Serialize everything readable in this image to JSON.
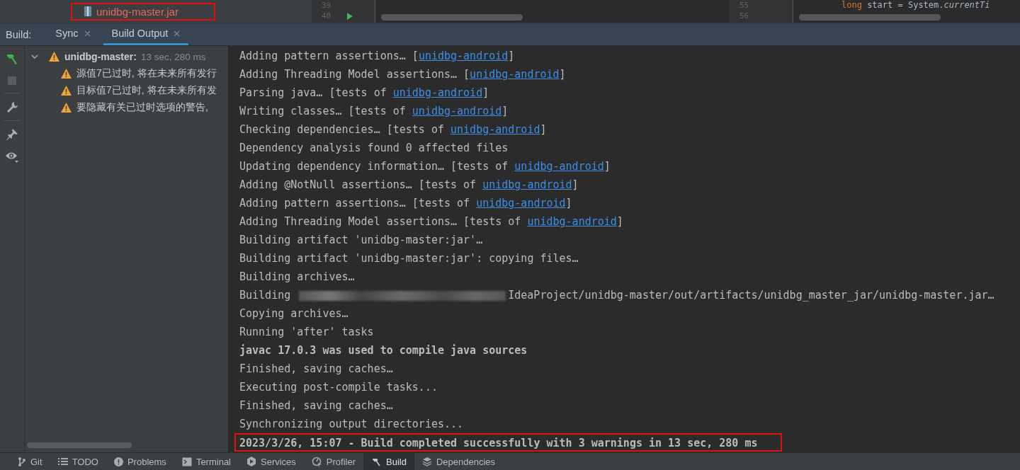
{
  "project_tree": {
    "item": "unidbg-master.jar",
    "highlighted": true
  },
  "editors": [
    {
      "line_numbers": [
        "39",
        "40"
      ],
      "run_marker": true
    },
    {
      "line_numbers": [
        "55",
        "56"
      ],
      "code": [
        {
          "kind": "keyword",
          "text": "long"
        },
        {
          "kind": "plain",
          "text": " start = System."
        },
        {
          "kind": "italic",
          "text": "currentTi"
        }
      ]
    }
  ],
  "build_tabs": {
    "label": "Build:",
    "tabs": [
      {
        "label": "Sync",
        "selected": false
      },
      {
        "label": "Build Output",
        "selected": true
      }
    ]
  },
  "tree": {
    "label": "unidbg-master:",
    "time": "13 sec, 280 ms",
    "expanded": true,
    "children": [
      {
        "label": "源值7已过时, 将在未来所有发行"
      },
      {
        "label": "目标值7已过时, 将在未来所有发"
      },
      {
        "label": "要隐藏有关已过时选项的警告,"
      }
    ]
  },
  "output": {
    "lines": [
      {
        "kind": "normal",
        "parts": [
          {
            "kind": "text",
            "text": "Adding pattern assertions… ["
          },
          {
            "kind": "link",
            "text": "unidbg-android"
          },
          {
            "kind": "text",
            "text": "]"
          }
        ]
      },
      {
        "kind": "normal",
        "parts": [
          {
            "kind": "text",
            "text": "Adding Threading Model assertions… ["
          },
          {
            "kind": "link",
            "text": "unidbg-android"
          },
          {
            "kind": "text",
            "text": "]"
          }
        ]
      },
      {
        "kind": "normal",
        "parts": [
          {
            "kind": "text",
            "text": "Parsing java… [tests of "
          },
          {
            "kind": "link",
            "text": "unidbg-android"
          },
          {
            "kind": "text",
            "text": "]"
          }
        ]
      },
      {
        "kind": "normal",
        "parts": [
          {
            "kind": "text",
            "text": "Writing classes… [tests of "
          },
          {
            "kind": "link",
            "text": "unidbg-android"
          },
          {
            "kind": "text",
            "text": "]"
          }
        ]
      },
      {
        "kind": "normal",
        "parts": [
          {
            "kind": "text",
            "text": "Checking dependencies… [tests of "
          },
          {
            "kind": "link",
            "text": "unidbg-android"
          },
          {
            "kind": "text",
            "text": "]"
          }
        ]
      },
      {
        "kind": "normal",
        "parts": [
          {
            "kind": "text",
            "text": "Dependency analysis found 0 affected files"
          }
        ]
      },
      {
        "kind": "normal",
        "parts": [
          {
            "kind": "text",
            "text": "Updating dependency information… [tests of "
          },
          {
            "kind": "link",
            "text": "unidbg-android"
          },
          {
            "kind": "text",
            "text": "]"
          }
        ]
      },
      {
        "kind": "normal",
        "parts": [
          {
            "kind": "text",
            "text": "Adding @NotNull assertions… [tests of "
          },
          {
            "kind": "link",
            "text": "unidbg-android"
          },
          {
            "kind": "text",
            "text": "]"
          }
        ]
      },
      {
        "kind": "normal",
        "parts": [
          {
            "kind": "text",
            "text": "Adding pattern assertions… [tests of "
          },
          {
            "kind": "link",
            "text": "unidbg-android"
          },
          {
            "kind": "text",
            "text": "]"
          }
        ]
      },
      {
        "kind": "normal",
        "parts": [
          {
            "kind": "text",
            "text": "Adding Threading Model assertions… [tests of "
          },
          {
            "kind": "link",
            "text": "unidbg-android"
          },
          {
            "kind": "text",
            "text": "]"
          }
        ]
      },
      {
        "kind": "normal",
        "parts": [
          {
            "kind": "text",
            "text": "Building artifact 'unidbg-master:jar'…"
          }
        ]
      },
      {
        "kind": "normal",
        "parts": [
          {
            "kind": "text",
            "text": "Building artifact 'unidbg-master:jar': copying files…"
          }
        ]
      },
      {
        "kind": "normal",
        "parts": [
          {
            "kind": "text",
            "text": "Building archives…"
          }
        ]
      },
      {
        "kind": "normal",
        "parts": [
          {
            "kind": "text",
            "text": "Building"
          },
          {
            "kind": "redacted"
          },
          {
            "kind": "text",
            "text": "IdeaProject/unidbg-master/out/artifacts/unidbg_master_jar/unidbg-master.jar…"
          }
        ]
      },
      {
        "kind": "normal",
        "parts": [
          {
            "kind": "text",
            "text": "Copying archives…"
          }
        ]
      },
      {
        "kind": "normal",
        "parts": [
          {
            "kind": "text",
            "text": "Running 'after' tasks"
          }
        ]
      },
      {
        "kind": "bold",
        "parts": [
          {
            "kind": "text",
            "text": "javac 17.0.3 was used to compile java sources"
          }
        ]
      },
      {
        "kind": "normal",
        "parts": [
          {
            "kind": "text",
            "text": "Finished, saving caches…"
          }
        ]
      },
      {
        "kind": "normal",
        "parts": [
          {
            "kind": "text",
            "text": "Executing post-compile tasks..."
          }
        ]
      },
      {
        "kind": "normal",
        "parts": [
          {
            "kind": "text",
            "text": "Finished, saving caches…"
          }
        ]
      },
      {
        "kind": "normal",
        "parts": [
          {
            "kind": "text",
            "text": "Synchronizing output directories..."
          }
        ]
      },
      {
        "kind": "result",
        "parts": [
          {
            "kind": "text",
            "text": "2023/3/26, 15:07 - Build completed successfully with 3 warnings in 13 sec, 280 ms"
          }
        ]
      }
    ]
  },
  "tool_windows": [
    {
      "kind": "git",
      "label": "Git",
      "selected": false
    },
    {
      "kind": "todo",
      "label": "TODO",
      "selected": false
    },
    {
      "kind": "problems",
      "label": "Problems",
      "selected": false
    },
    {
      "kind": "terminal",
      "label": "Terminal",
      "selected": false
    },
    {
      "kind": "services",
      "label": "Services",
      "selected": false
    },
    {
      "kind": "profiler",
      "label": "Profiler",
      "selected": false
    },
    {
      "kind": "build",
      "label": "Build",
      "selected": true
    },
    {
      "kind": "dependencies",
      "label": "Dependencies",
      "selected": false
    }
  ]
}
